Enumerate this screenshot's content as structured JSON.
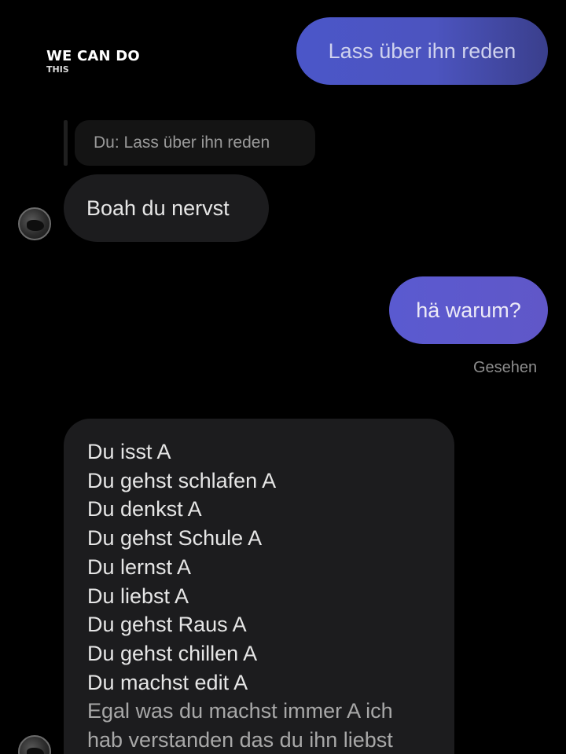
{
  "watermark": {
    "title": "WE CAN DO",
    "subtitle": "THIS"
  },
  "messages": {
    "outgoing_1": "Lass über ihn reden",
    "reply_quote": "Du: Lass über ihn reden",
    "incoming_1": "Boah du nervst",
    "outgoing_2": "hä warum?",
    "seen_status": "Gesehen",
    "incoming_2_lines": [
      "Du isst A",
      "Du gehst schlafen A",
      "Du denkst A",
      "Du gehst Schule A",
      "Du lernst A",
      "Du liebst A",
      "Du gehst Raus A",
      "Du gehst chillen A",
      "Du machst edit A",
      "Egal was du machst immer A ich",
      "hab verstanden das du ihn liebst"
    ]
  },
  "avatars": {
    "icon": "contact-avatar-icon"
  },
  "colors": {
    "background": "#000000",
    "outgoing_bubble": "#4c54bf",
    "incoming_bubble": "#1c1c1e",
    "status_text": "#8d8d8d"
  }
}
